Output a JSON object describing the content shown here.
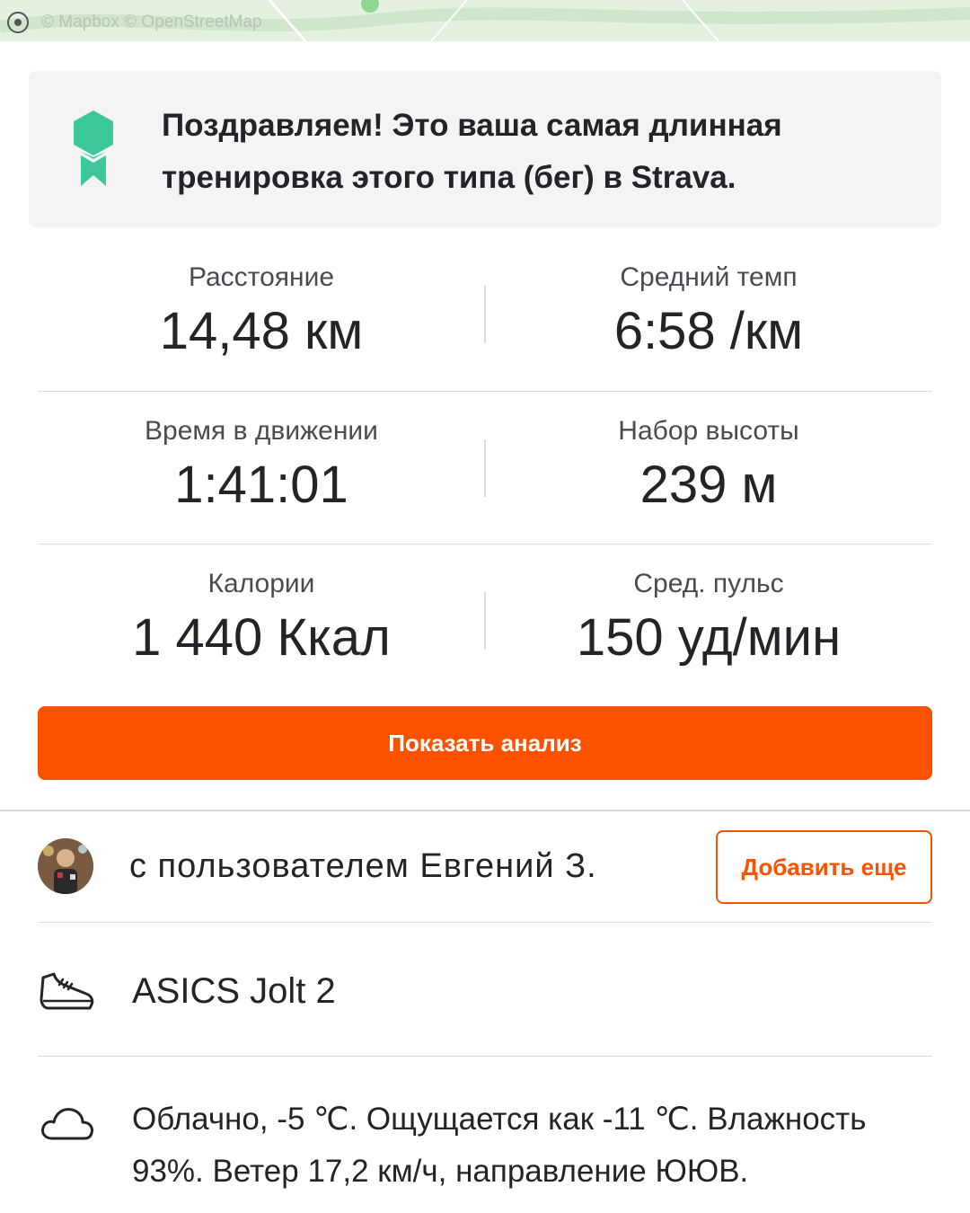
{
  "map": {
    "attribution": "© Mapbox © OpenStreetMap"
  },
  "achievement": {
    "text": "Поздравляем! Это ваша самая длинная тренировка этого типа (бег) в Strava."
  },
  "stats": [
    {
      "left_label": "Расстояние",
      "left_value": "14,48 км",
      "right_label": "Средний темп",
      "right_value": "6:58 /км"
    },
    {
      "left_label": "Время в движении",
      "left_value": "1:41:01",
      "right_label": "Набор высоты",
      "right_value": "239 м"
    },
    {
      "left_label": "Калории",
      "left_value": "1 440 Ккал",
      "right_label": "Сред. пульс",
      "right_value": "150 уд/мин"
    }
  ],
  "analysis_button": "Показать анализ",
  "with_user": {
    "text": "с пользователем Евгений З.",
    "add_button": "Добавить еще"
  },
  "gear": {
    "name": "ASICS Jolt 2",
    "icon": "shoe-icon"
  },
  "weather": {
    "text": "Облачно, -5 ℃. Ощущается как -11 ℃. Влажность 93%. Ветер 17,2 км/ч, направление ЮЮВ.",
    "icon": "cloud-icon"
  },
  "colors": {
    "accent": "#fc5200",
    "badge": "#3cc89a",
    "card_bg": "#f4f4f6"
  }
}
